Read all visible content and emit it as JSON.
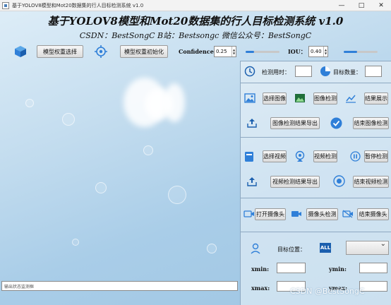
{
  "window": {
    "title": "基于YOLOV8模型和Mot20数据集的行人目标检测系统 v1.0",
    "minimize": "—",
    "maximize": "□",
    "close": "✕"
  },
  "header": {
    "title": "基于YOLOV8模型和Mot20数据集的行人目标检测系统 v1.0",
    "subtitle": "CSDN：BestSongC   B站：Bestsongc   微信公众号：BestSongC"
  },
  "toolbar": {
    "select_weights": "模型权重选择",
    "init_weights": "模型权重初始化",
    "confidence_label": "Confidence:",
    "confidence_value": "0.25",
    "iou_label": "IOU：",
    "iou_value": "0.40"
  },
  "sliders": {
    "confidence_level": 0.25,
    "iou_level": 0.4
  },
  "stats": {
    "time_label": "检测用时：",
    "time_value": "",
    "count_label": "目标数量：",
    "count_value": ""
  },
  "image_section": {
    "select": "选择图像",
    "detect": "图像检测",
    "show": "结果展示",
    "export": "图像检测结果导出",
    "stop": "结束图像检测"
  },
  "video_section": {
    "select": "选择视频",
    "detect": "视频检测",
    "pause": "暂停检测",
    "export": "视频检测结果导出",
    "stop": "结束视频检测"
  },
  "camera_section": {
    "open": "打开摄像头",
    "detect": "摄像头检测",
    "stop": "结束摄像头"
  },
  "target": {
    "position_label": "目标位置：",
    "all_badge": "ALL",
    "selected": "",
    "xmin_label": "xmin:",
    "ymin_label": "ymin:",
    "xmax_label": "xmax:",
    "ymax_label": "ymax:",
    "xmin": "",
    "ymin": "",
    "xmax": "",
    "ymax": ""
  },
  "status": {
    "placeholder": "输出状态监测框"
  },
  "watermark": "CSDN @BestSongC"
}
